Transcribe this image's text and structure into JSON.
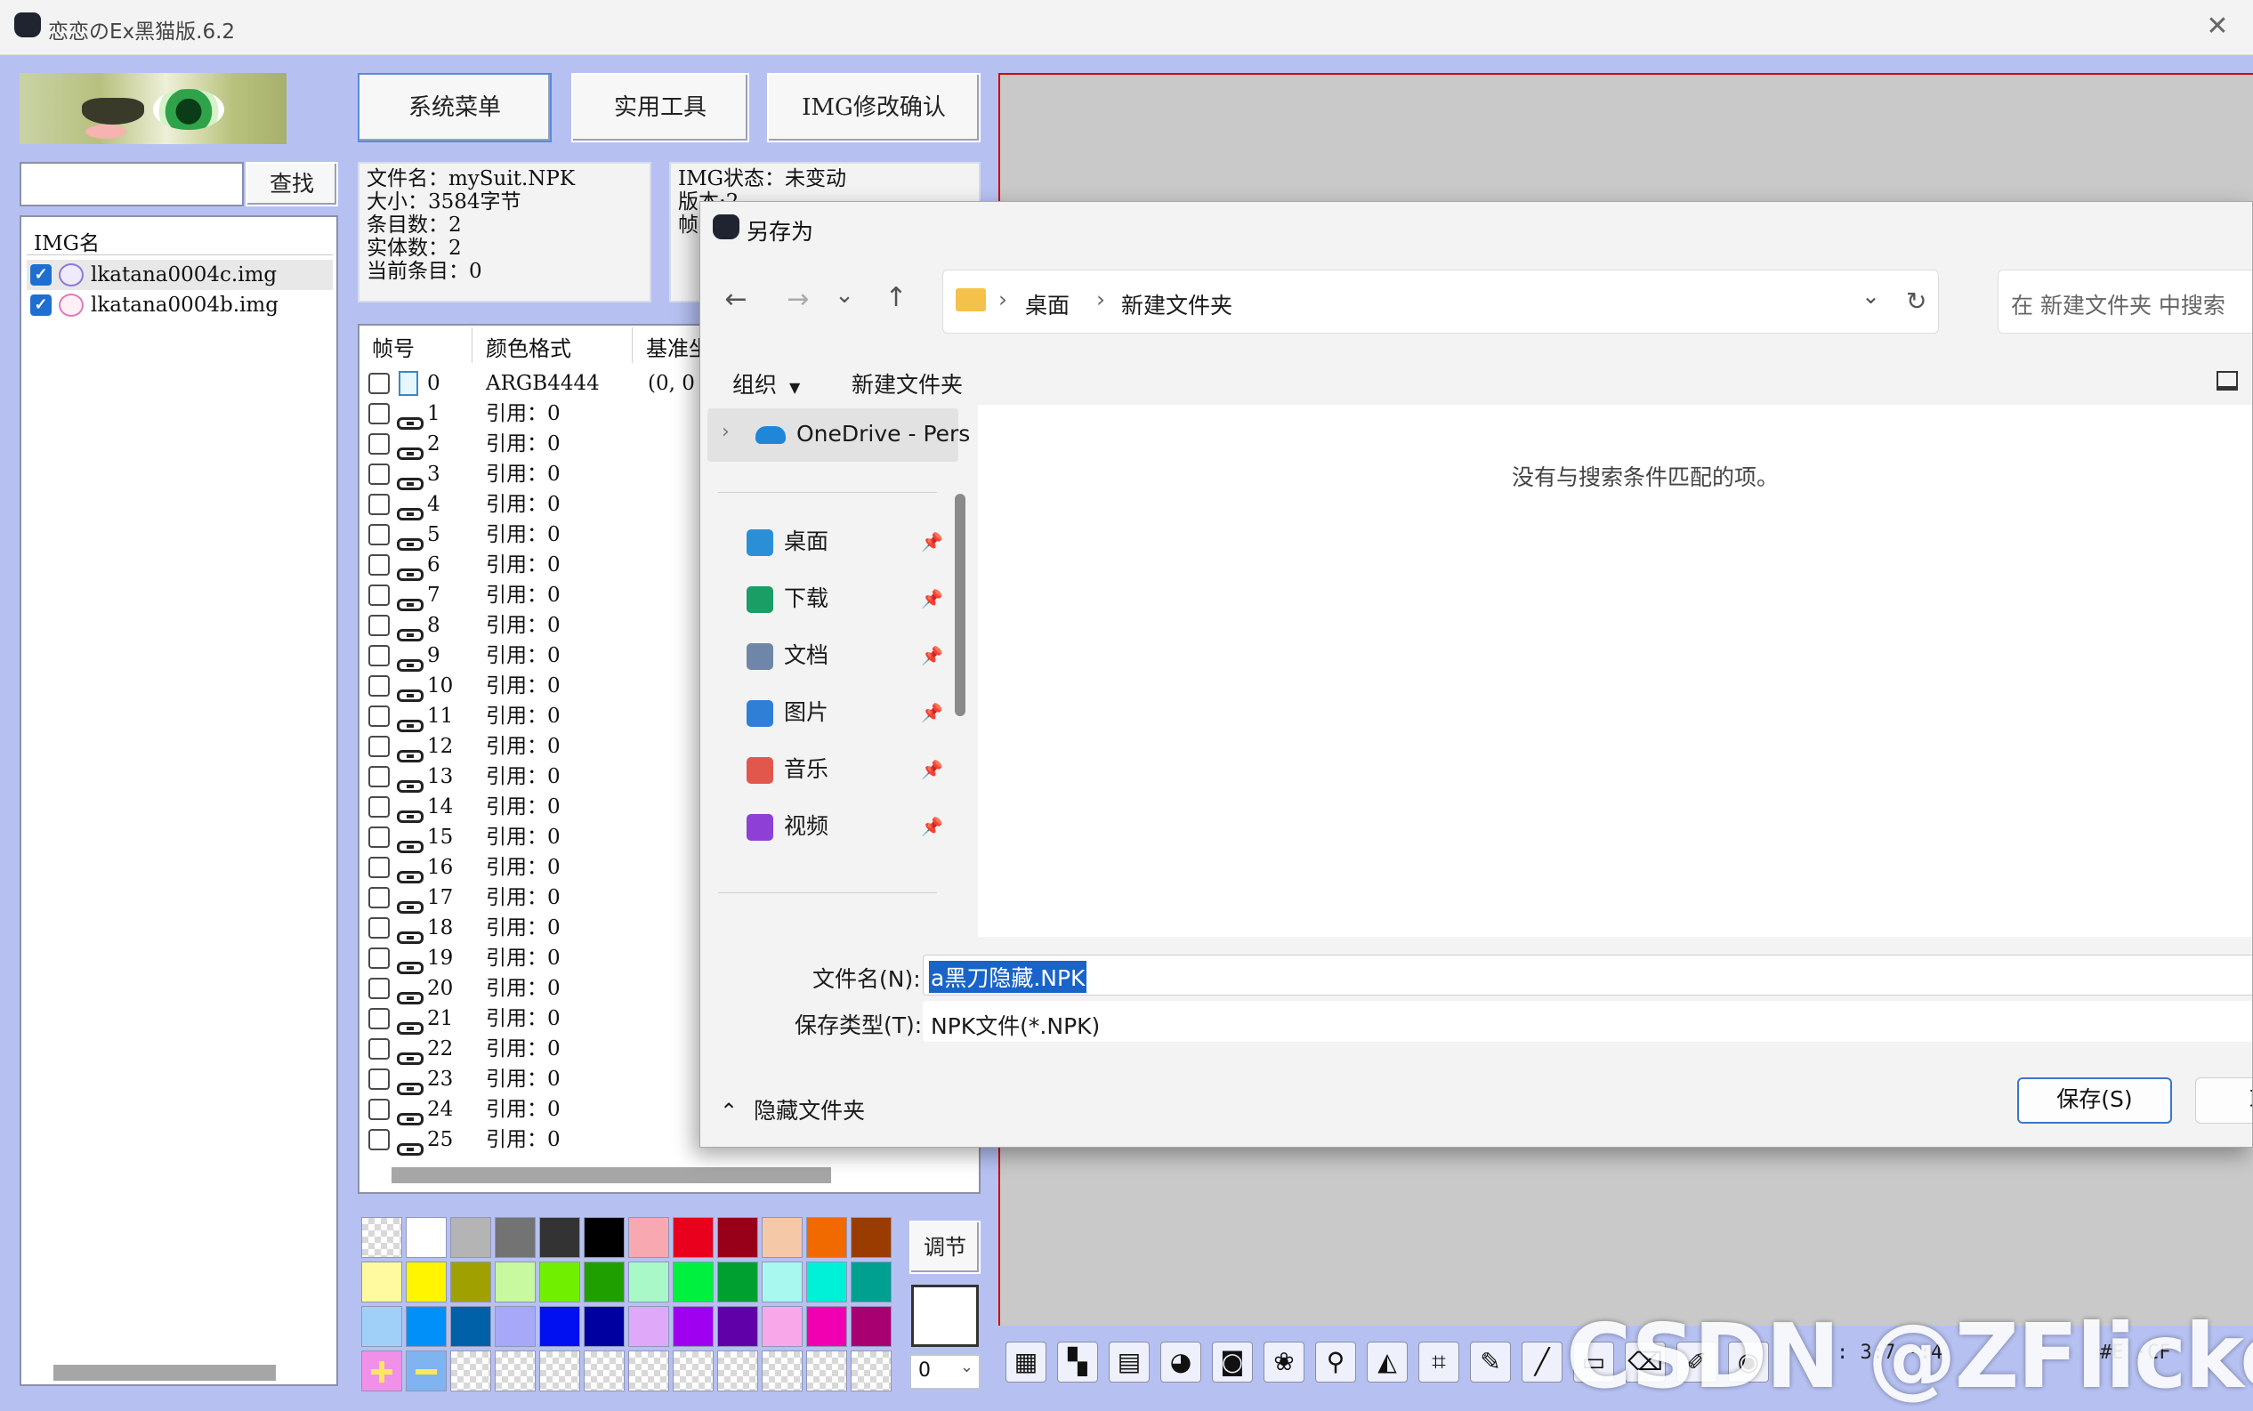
{
  "app": {
    "title": "恋恋のEx黑猫版.6.2",
    "close_glyph": "✕"
  },
  "toolbar": {
    "system_menu": "系统菜单",
    "tools": "实用工具",
    "img_confirm": "IMG修改确认"
  },
  "search": {
    "button": "查找",
    "value": ""
  },
  "img_list": {
    "header": "IMG名",
    "items": [
      {
        "name": "lkatana0004c.img",
        "checked": true
      },
      {
        "name": "lkatana0004b.img",
        "checked": true
      }
    ]
  },
  "file_info": {
    "name": "文件名：mySuit.NPK",
    "size": "大小：3584字节",
    "entries": "条目数：2",
    "entities": "实体数：2",
    "current": "当前条目：0"
  },
  "img_info": {
    "status": "IMG状态：未变动",
    "version": "版本:2",
    "frames": "帧"
  },
  "frame_table": {
    "headers": [
      "帧号",
      "颜色格式",
      "基准坐"
    ],
    "first_row": {
      "id": "0",
      "format": "ARGB4444",
      "base": "(0, 0"
    },
    "ref_text": "引用：0",
    "ref_ids": [
      "1",
      "2",
      "3",
      "4",
      "5",
      "6",
      "7",
      "8",
      "9",
      "10",
      "11",
      "12",
      "13",
      "14",
      "15",
      "16",
      "17",
      "18",
      "19",
      "20",
      "21",
      "22",
      "23",
      "24",
      "25"
    ]
  },
  "palette": {
    "colors": [
      "checker",
      "#ffffff",
      "#b4b4b4",
      "#737373",
      "#333333",
      "#000000",
      "#f8a8b0",
      "#e8001c",
      "#98001a",
      "#f5c8a8",
      "#f06a00",
      "#9a3c00",
      "#fffaa0",
      "#fff500",
      "#a0a000",
      "#c8f8a0",
      "#70f000",
      "#20a000",
      "#a8f8c8",
      "#00f040",
      "#00a030",
      "#a8f8f0",
      "#00f0d8",
      "#00a090",
      "#a0d0f8",
      "#0090f8",
      "#0060a8",
      "#a8a8f8",
      "#0010f0",
      "#0000a0",
      "#e0a8f8",
      "#a000f0",
      "#6000a8",
      "#f8a8e8",
      "#f000b0",
      "#a80070",
      "plus",
      "minus",
      "checker",
      "checker",
      "checker",
      "checker",
      "checker",
      "checker",
      "checker",
      "checker",
      "checker",
      "checker"
    ],
    "adjust_label": "调节",
    "select_value": "0"
  },
  "bottom_tools": {
    "icons": [
      "image-frame-icon",
      "palette-grid-icon",
      "film-icon",
      "cat-icon",
      "camera-icon",
      "paw-icon",
      "magnifier-icon",
      "transform-icon",
      "crop-icon",
      "pencil-icon",
      "line-icon",
      "rectangle-icon",
      "eraser-icon",
      "brush-icon",
      "color-pick-icon"
    ],
    "coord_text": ": 3:7  ·:4",
    "color_text": "#E      ·CF"
  },
  "dialog": {
    "title": "另存为",
    "breadcrumb": [
      "桌面",
      "新建文件夹"
    ],
    "search_placeholder": "在 新建文件夹 中搜索",
    "organize": "组织",
    "new_folder": "新建文件夹",
    "empty_message": "没有与搜索条件匹配的项。",
    "nav": {
      "onedrive": "OneDrive - Pers",
      "quick_access": [
        {
          "label": "桌面",
          "icon": "desktop-icon",
          "color": "#2b8fd8"
        },
        {
          "label": "下载",
          "icon": "download-icon",
          "color": "#1a9e66"
        },
        {
          "label": "文档",
          "icon": "document-icon",
          "color": "#6f86a8"
        },
        {
          "label": "图片",
          "icon": "picture-icon",
          "color": "#2f7fd6"
        },
        {
          "label": "音乐",
          "icon": "music-icon",
          "color": "#e2574c"
        },
        {
          "label": "视频",
          "icon": "video-icon",
          "color": "#8d3fd6"
        }
      ]
    },
    "filename_label": "文件名(N):",
    "filename_value": "a黑刀隐藏.NPK",
    "filetype_label": "保存类型(T):",
    "filetype_value": "NPK文件(*.NPK)",
    "hide_folders": "隐藏文件夹",
    "save_button": "保存(S)",
    "cancel_button": "取消"
  },
  "watermark": "CSDN @ZFlicker"
}
